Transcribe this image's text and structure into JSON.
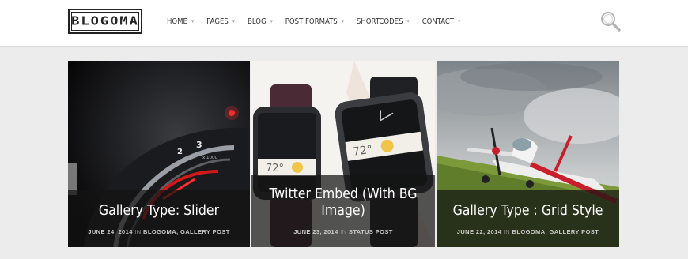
{
  "header": {
    "logo_text": "BLOGOMA",
    "nav": [
      {
        "label": "HOME"
      },
      {
        "label": "PAGES"
      },
      {
        "label": "BLOG"
      },
      {
        "label": "POST FORMATS"
      },
      {
        "label": "SHORTCODES"
      },
      {
        "label": "CONTACT"
      }
    ],
    "search_icon": "search-icon"
  },
  "posts": [
    {
      "title": "Gallery Type: Slider",
      "date": "JUNE 24, 2014",
      "in": "IN",
      "categories": "BLOGOMA, GALLERY POST",
      "image": "dashboard-speedometer"
    },
    {
      "title": "Twitter Embed (With BG Image)",
      "date": "JUNE 23, 2014",
      "in": "IN",
      "categories": "STATUS POST",
      "image": "smartwatches",
      "watch_temp": "72°"
    },
    {
      "title": "Gallery Type : Grid Style",
      "date": "JUNE 22, 2014",
      "in": "IN",
      "categories": "BLOGOMA, GALLERY POST",
      "image": "propeller-airplane"
    }
  ],
  "colors": {
    "overlay": "#141414",
    "page_bg": "#ececec",
    "header_bg": "#ffffff"
  }
}
